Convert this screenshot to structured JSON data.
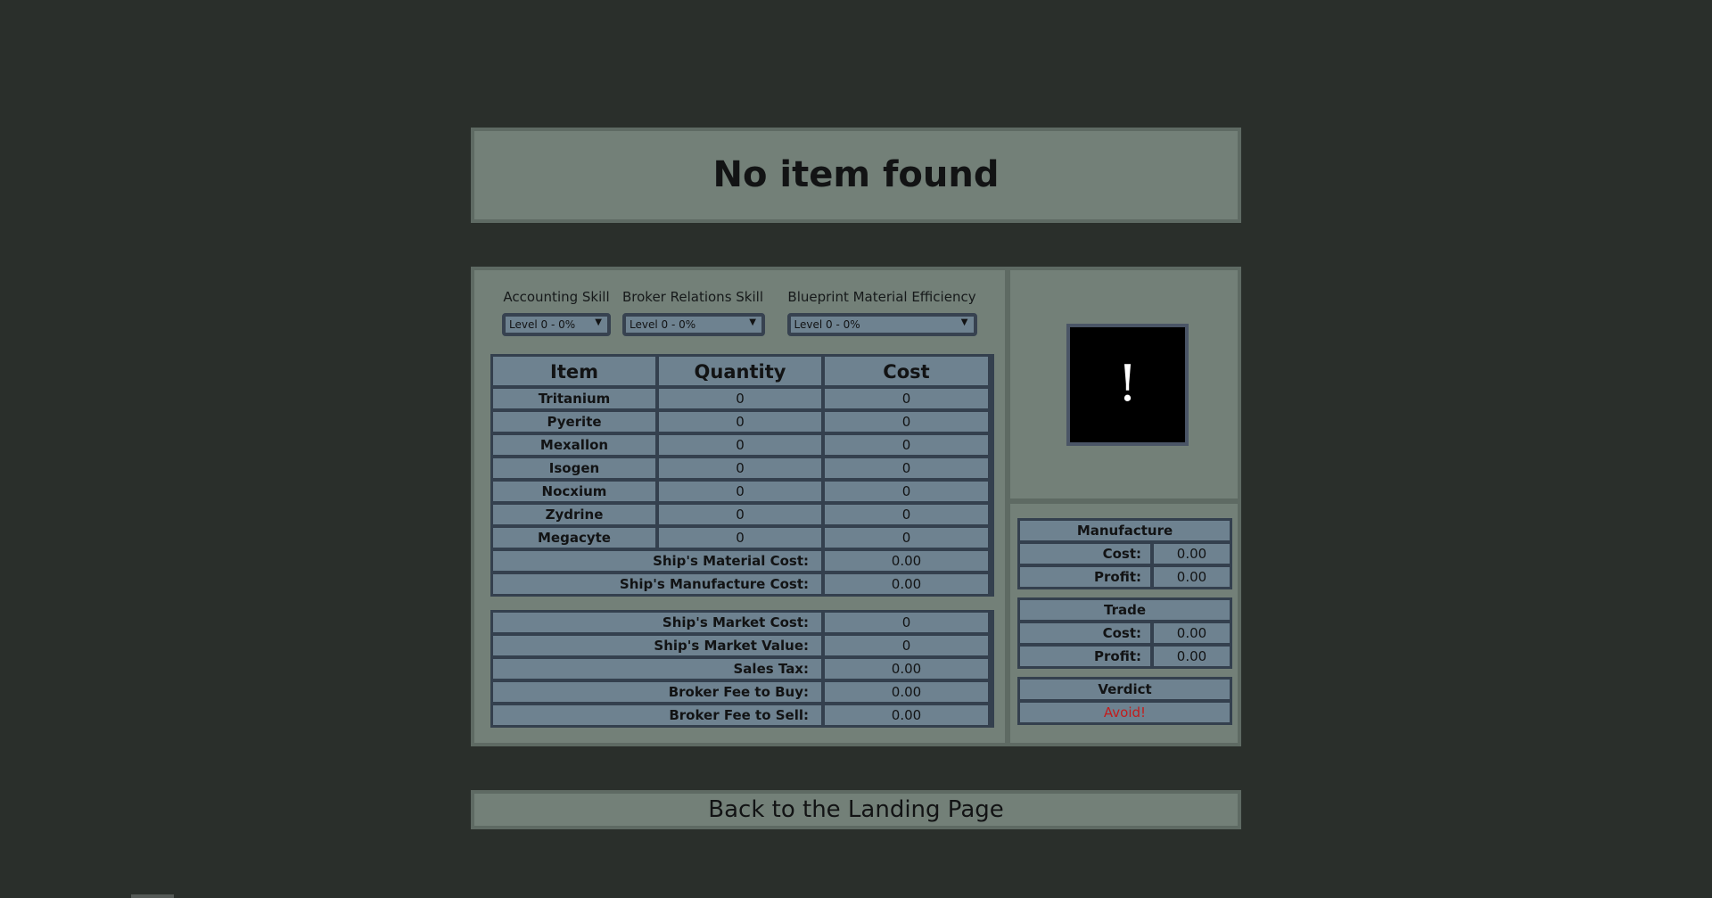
{
  "title": "No item found",
  "skills": [
    {
      "label": "Accounting Skill",
      "value": "Level 0 - 0%"
    },
    {
      "label": "Broker Relations Skill",
      "value": "Level 0 - 0%"
    },
    {
      "label": "Blueprint Material Efficiency",
      "value": "Level 0 - 0%"
    }
  ],
  "materials": {
    "headers": [
      "Item",
      "Quantity",
      "Cost"
    ],
    "rows": [
      {
        "item": "Tritanium",
        "quantity": "0",
        "cost": "0"
      },
      {
        "item": "Pyerite",
        "quantity": "0",
        "cost": "0"
      },
      {
        "item": "Mexallon",
        "quantity": "0",
        "cost": "0"
      },
      {
        "item": "Isogen",
        "quantity": "0",
        "cost": "0"
      },
      {
        "item": "Nocxium",
        "quantity": "0",
        "cost": "0"
      },
      {
        "item": "Zydrine",
        "quantity": "0",
        "cost": "0"
      },
      {
        "item": "Megacyte",
        "quantity": "0",
        "cost": "0"
      }
    ],
    "material_cost": {
      "label": "Ship's Material Cost:",
      "value": "0.00"
    },
    "manufacture_cost": {
      "label": "Ship's Manufacture Cost:",
      "value": "0.00"
    }
  },
  "market": [
    {
      "label": "Ship's Market Cost:",
      "value": "0"
    },
    {
      "label": "Ship's Market Value:",
      "value": "0"
    },
    {
      "label": "Sales Tax:",
      "value": "0.00"
    },
    {
      "label": "Broker Fee to Buy:",
      "value": "0.00"
    },
    {
      "label": "Broker Fee to Sell:",
      "value": "0.00"
    }
  ],
  "item_icon": {
    "glyph": "!",
    "icon": "exclamation-icon"
  },
  "manufacture": {
    "title": "Manufacture",
    "cost_label": "Cost:",
    "cost": "0.00",
    "profit_label": "Profit:",
    "profit": "0.00"
  },
  "trade": {
    "title": "Trade",
    "cost_label": "Cost:",
    "cost": "0.00",
    "profit_label": "Profit:",
    "profit": "0.00"
  },
  "verdict": {
    "title": "Verdict",
    "value": "Avoid!",
    "color": "#c21d1d"
  },
  "back_link": "Back to the Landing Page"
}
